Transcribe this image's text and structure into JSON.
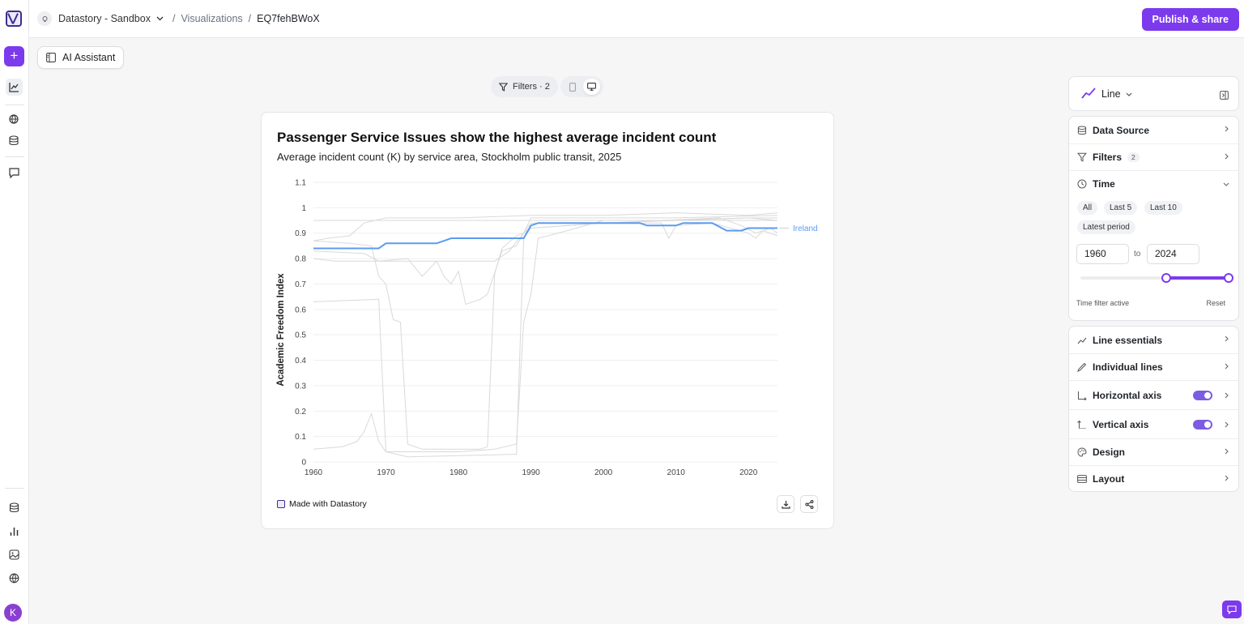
{
  "colors": {
    "accent": "#7c3aed",
    "series_highlight": "#5b9bef",
    "series_muted": "#d9d9d9"
  },
  "topbar": {
    "workspace": "Datastory - Sandbox",
    "breadcrumb_section": "Visualizations",
    "breadcrumb_current": "EQ7fehBWoX",
    "publish_label": "Publish & share"
  },
  "ai_assistant": {
    "label": "AI Assistant"
  },
  "canvas_toolbar": {
    "filters_label": "Filters · 2"
  },
  "card": {
    "made_with": "Made with Datastory"
  },
  "chart_data": {
    "type": "line",
    "title": "Passenger Service Issues show the highest average incident count",
    "subtitle": "Average incident count (K) by service area, Stockholm public transit, 2025",
    "ylabel": "Academic Freedom Index",
    "xlabel": "",
    "xlim": [
      1960,
      2024
    ],
    "ylim": [
      0,
      1.1
    ],
    "x_ticks": [
      "1960",
      "1970",
      "1980",
      "1990",
      "2000",
      "2010",
      "2020"
    ],
    "y_ticks": [
      "0",
      "0.1",
      "0.2",
      "0.3",
      "0.4",
      "0.5",
      "0.6",
      "0.7",
      "0.8",
      "0.9",
      "1",
      "1.1"
    ],
    "highlighted_label": "Ireland",
    "series": [
      {
        "name": "Ireland",
        "highlight": true,
        "points": [
          [
            1960,
            0.84
          ],
          [
            1969,
            0.84
          ],
          [
            1970,
            0.86
          ],
          [
            1977,
            0.86
          ],
          [
            1979,
            0.88
          ],
          [
            1989,
            0.88
          ],
          [
            1990,
            0.93
          ],
          [
            1991,
            0.94
          ],
          [
            2005,
            0.94
          ],
          [
            2006,
            0.93
          ],
          [
            2009,
            0.93
          ],
          [
            2010,
            0.93
          ],
          [
            2011,
            0.94
          ],
          [
            2014,
            0.94
          ],
          [
            2015,
            0.94
          ],
          [
            2017,
            0.91
          ],
          [
            2019,
            0.91
          ],
          [
            2020,
            0.92
          ],
          [
            2024,
            0.92
          ]
        ]
      },
      {
        "highlight": false,
        "points": [
          [
            1960,
            0.87
          ],
          [
            1965,
            0.86
          ],
          [
            1968,
            0.85
          ],
          [
            1969,
            0.73
          ],
          [
            1970,
            0.7
          ],
          [
            1971,
            0.56
          ],
          [
            1972,
            0.55
          ],
          [
            1973,
            0.07
          ],
          [
            1975,
            0.05
          ],
          [
            1983,
            0.05
          ],
          [
            1984,
            0.06
          ],
          [
            1985,
            0.74
          ],
          [
            1986,
            0.84
          ],
          [
            1988,
            0.89
          ],
          [
            1989,
            0.9
          ],
          [
            1990,
            0.96
          ],
          [
            2000,
            0.96
          ],
          [
            2010,
            0.96
          ],
          [
            2024,
            0.97
          ]
        ]
      },
      {
        "highlight": false,
        "points": [
          [
            1960,
            0.05
          ],
          [
            1964,
            0.06
          ],
          [
            1966,
            0.08
          ],
          [
            1967,
            0.12
          ],
          [
            1968,
            0.19
          ],
          [
            1969,
            0.08
          ],
          [
            1970,
            0.04
          ],
          [
            1980,
            0.04
          ],
          [
            1985,
            0.05
          ],
          [
            1988,
            0.07
          ],
          [
            1989,
            0.55
          ],
          [
            1990,
            0.66
          ],
          [
            1991,
            0.88
          ],
          [
            1995,
            0.91
          ],
          [
            2000,
            0.95
          ],
          [
            2010,
            0.95
          ],
          [
            2020,
            0.96
          ],
          [
            2024,
            0.96
          ]
        ]
      },
      {
        "highlight": false,
        "points": [
          [
            1960,
            0.87
          ],
          [
            1962,
            0.88
          ],
          [
            1965,
            0.89
          ],
          [
            1967,
            0.94
          ],
          [
            1970,
            0.96
          ],
          [
            1980,
            0.96
          ],
          [
            1990,
            0.97
          ],
          [
            2000,
            0.97
          ],
          [
            2010,
            0.98
          ],
          [
            2020,
            0.97
          ],
          [
            2024,
            0.98
          ]
        ]
      },
      {
        "highlight": false,
        "points": [
          [
            1960,
            0.95
          ],
          [
            1970,
            0.95
          ],
          [
            1980,
            0.95
          ],
          [
            1990,
            0.95
          ],
          [
            2000,
            0.95
          ],
          [
            2010,
            0.95
          ],
          [
            2020,
            0.95
          ],
          [
            2024,
            0.95
          ]
        ]
      },
      {
        "highlight": false,
        "points": [
          [
            1960,
            0.83
          ],
          [
            1967,
            0.82
          ],
          [
            1969,
            0.79
          ],
          [
            1973,
            0.8
          ],
          [
            1975,
            0.73
          ],
          [
            1977,
            0.79
          ],
          [
            1978,
            0.73
          ],
          [
            1979,
            0.7
          ],
          [
            1980,
            0.75
          ],
          [
            1981,
            0.62
          ],
          [
            1983,
            0.64
          ],
          [
            1984,
            0.66
          ],
          [
            1986,
            0.83
          ],
          [
            1988,
            0.85
          ],
          [
            1989,
            0.9
          ],
          [
            1990,
            0.94
          ],
          [
            2000,
            0.94
          ],
          [
            2008,
            0.94
          ],
          [
            2009,
            0.88
          ],
          [
            2010,
            0.93
          ],
          [
            2015,
            0.94
          ],
          [
            2020,
            0.9
          ],
          [
            2021,
            0.88
          ],
          [
            2022,
            0.91
          ],
          [
            2024,
            0.89
          ]
        ]
      },
      {
        "highlight": false,
        "points": [
          [
            1960,
            0.63
          ],
          [
            1969,
            0.64
          ],
          [
            1970,
            0.04
          ],
          [
            1973,
            0.02
          ],
          [
            1988,
            0.03
          ],
          [
            1989,
            0.88
          ],
          [
            1990,
            0.92
          ],
          [
            2000,
            0.94
          ],
          [
            2010,
            0.95
          ],
          [
            2020,
            0.96
          ],
          [
            2024,
            0.95
          ]
        ]
      },
      {
        "highlight": false,
        "points": [
          [
            1960,
            0.8
          ],
          [
            1963,
            0.79
          ],
          [
            1970,
            0.79
          ],
          [
            1975,
            0.79
          ],
          [
            1980,
            0.79
          ],
          [
            1985,
            0.79
          ],
          [
            1987,
            0.83
          ],
          [
            1989,
            0.9
          ],
          [
            1990,
            0.92
          ],
          [
            2000,
            0.94
          ],
          [
            2016,
            0.96
          ],
          [
            2019,
            0.93
          ],
          [
            2021,
            0.9
          ],
          [
            2023,
            0.92
          ],
          [
            2024,
            0.9
          ]
        ]
      }
    ]
  },
  "panel": {
    "chart_type": "Line",
    "data_source": "Data Source",
    "filters": "Filters",
    "filters_count": "2",
    "time": "Time",
    "time_chips": [
      "All",
      "Last 5",
      "Last 10",
      "Latest period"
    ],
    "time_from": "1960",
    "time_to_word": "to",
    "time_to": "2024",
    "time_range_fraction": [
      0.58,
      1.0
    ],
    "time_filter_status": "Time filter active",
    "time_reset": "Reset",
    "line_essentials": "Line essentials",
    "individual_lines": "Individual lines",
    "horizontal_axis": "Horizontal axis",
    "horizontal_axis_enabled": true,
    "vertical_axis": "Vertical axis",
    "vertical_axis_enabled": true,
    "design": "Design",
    "layout": "Layout"
  }
}
